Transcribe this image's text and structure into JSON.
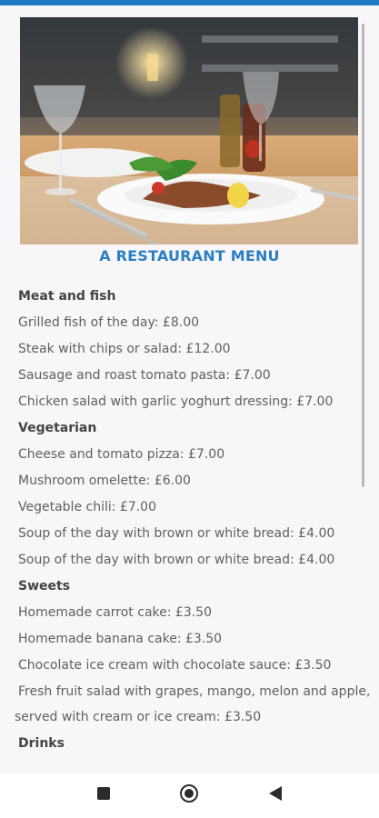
{
  "header": {
    "title": "A RESTAURANT MENU"
  },
  "hero": {
    "image_label": "restaurant-table-photo"
  },
  "menu": {
    "sections": [
      {
        "heading": "Meat and fish",
        "items": [
          "Grilled fish of the day: £8.00",
          "Steak with chips or salad: £12.00",
          "Sausage and roast tomato pasta: £7.00",
          "Chicken salad with garlic yoghurt dressing: £7.00"
        ]
      },
      {
        "heading": "Vegetarian",
        "items": [
          "Cheese and tomato pizza: £7.00",
          "Mushroom omelette: £6.00",
          "Vegetable chili: £7.00",
          "Soup of the day with brown or white bread: £4.00",
          "Soup of the day with brown or white bread: £4.00"
        ]
      },
      {
        "heading": "Sweets",
        "items": [
          "Homemade carrot cake: £3.50",
          "Homemade banana cake: £3.50",
          "Chocolate ice cream with chocolate sauce: £3.50",
          "Fresh fruit salad with grapes, mango, melon and apple,",
          "served with cream or ice cream: £3.50"
        ]
      },
      {
        "heading": "Drinks",
        "items": []
      }
    ]
  },
  "nav": {
    "recents_icon": "square-icon",
    "home_icon": "circle-icon",
    "back_icon": "triangle-back-icon"
  },
  "colors": {
    "title": "#2b7fc2",
    "status_bar": "#1e7ac4"
  }
}
